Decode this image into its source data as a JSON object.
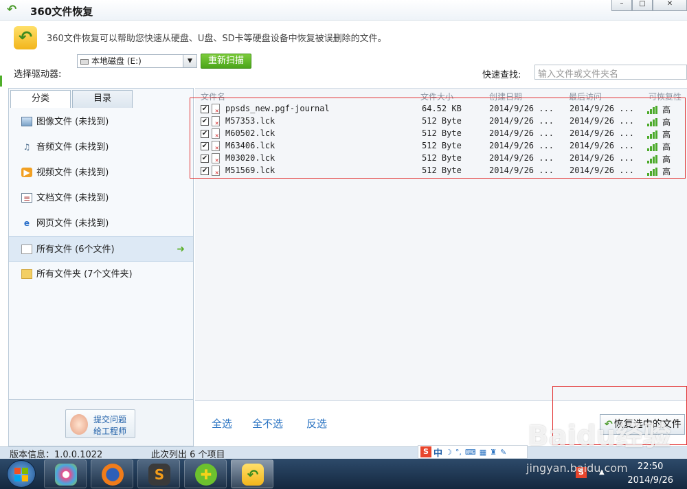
{
  "window": {
    "title": "360文件恢复",
    "controls": [
      "–",
      "□",
      "✕"
    ]
  },
  "header": {
    "intro": "360文件恢复可以帮助您快速从硬盘、U盘、SD卡等硬盘设备中恢复被误删除的文件。",
    "drive_label": "选择驱动器:",
    "drive_value": "本地磁盘 (E:)",
    "rescan_label": "重新扫描",
    "search_label": "快速查找:",
    "search_placeholder": "输入文件或文件夹名"
  },
  "tabs": [
    "分类",
    "目录"
  ],
  "categories": [
    {
      "label": "图像文件 (未找到)",
      "icon": "image-icon"
    },
    {
      "label": "音频文件 (未找到)",
      "icon": "music-icon"
    },
    {
      "label": "视频文件 (未找到)",
      "icon": "video-icon"
    },
    {
      "label": "文档文件 (未找到)",
      "icon": "document-icon"
    },
    {
      "label": "网页文件 (未找到)",
      "icon": "web-icon"
    },
    {
      "label": "所有文件 (6个文件)",
      "icon": "file-icon"
    },
    {
      "label": "所有文件夹 (7个文件夹)",
      "icon": "folder-icon"
    }
  ],
  "help": {
    "line1": "提交问题",
    "line2": "给工程师"
  },
  "columns": [
    "文件名",
    "文件大小",
    "创建日期",
    "最后访问",
    "可恢复性"
  ],
  "files": [
    {
      "name": "ppsds_new.pgf-journal",
      "size": "64.52 KB",
      "created": "2014/9/26 ...",
      "accessed": "2014/9/26 ...",
      "recoverability": "高"
    },
    {
      "name": "M57353.lck",
      "size": "512 Byte",
      "created": "2014/9/26 ...",
      "accessed": "2014/9/26 ...",
      "recoverability": "高"
    },
    {
      "name": "M60502.lck",
      "size": "512 Byte",
      "created": "2014/9/26 ...",
      "accessed": "2014/9/26 ...",
      "recoverability": "高"
    },
    {
      "name": "M63406.lck",
      "size": "512 Byte",
      "created": "2014/9/26 ...",
      "accessed": "2014/9/26 ...",
      "recoverability": "高"
    },
    {
      "name": "M03020.lck",
      "size": "512 Byte",
      "created": "2014/9/26 ...",
      "accessed": "2014/9/26 ...",
      "recoverability": "高"
    },
    {
      "name": "M51569.lck",
      "size": "512 Byte",
      "created": "2014/9/26 ...",
      "accessed": "2014/9/26 ...",
      "recoverability": "高"
    }
  ],
  "actions": {
    "select_all": "全选",
    "select_none": "全不选",
    "invert": "反选",
    "restore": "恢复选中的文件"
  },
  "status": {
    "version": "版本信息：1.0.0.1022",
    "count": "此次列出 6 个项目"
  },
  "ime": {
    "zh": "中"
  },
  "taskbar": {
    "time": "22:50",
    "date": "2014/9/26"
  },
  "watermark": {
    "main": "Baidu经验",
    "sub": "jingyan.baidu.com"
  },
  "colors": {
    "accent_green": "#4ba51a",
    "link_blue": "#2a73c2",
    "highlight_red": "#e23030"
  }
}
